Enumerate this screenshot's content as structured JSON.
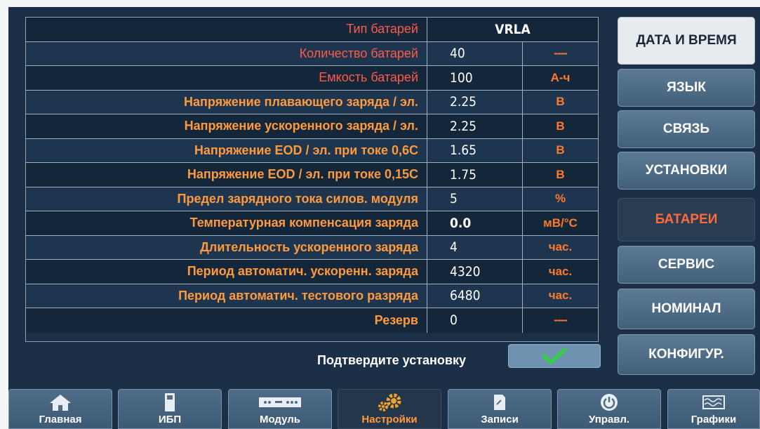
{
  "battery_table": {
    "rows": [
      {
        "label": "Тип батарей",
        "value": "VRLA",
        "unit": ""
      },
      {
        "label": "Количество батарей",
        "value": "40",
        "unit": "----"
      },
      {
        "label": "Емкость батарей",
        "value": "100",
        "unit": "А-ч"
      },
      {
        "label": "Напряжение плавающего заряда / эл.",
        "value": "2.25",
        "unit": "В"
      },
      {
        "label": "Напряжение ускоренного заряда / эл.",
        "value": "2.25",
        "unit": "В"
      },
      {
        "label": "Напряжение EOD / эл. при токе 0,6C",
        "value": "1.65",
        "unit": "В"
      },
      {
        "label": "Напряжение EOD / эл. при токе 0,15C",
        "value": "1.75",
        "unit": "В"
      },
      {
        "label": "Предел зарядного тока силов. модуля",
        "value": "5",
        "unit": "%"
      },
      {
        "label": "Температурная компенсация заряда",
        "value": "0.0",
        "unit": "мВ/°C"
      },
      {
        "label": "Длительность ускоренного заряда",
        "value": "4",
        "unit": "час."
      },
      {
        "label": "Период автоматич. ускоренн. заряда",
        "value": "4320",
        "unit": "час."
      },
      {
        "label": "Период автоматич. тестового разряда",
        "value": "6480",
        "unit": "час."
      },
      {
        "label": "Резерв",
        "value": "0",
        "unit": "----"
      }
    ]
  },
  "confirm": {
    "label": "Подтвердите установку"
  },
  "side_menu": {
    "items": [
      {
        "label": "ДАТА И ВРЕМЯ"
      },
      {
        "label": "ЯЗЫК"
      },
      {
        "label": "СВЯЗЬ"
      },
      {
        "label": "УСТАНОВКИ"
      },
      {
        "label": "БАТАРЕИ"
      },
      {
        "label": "СЕРВИС"
      },
      {
        "label": "НОМИНАЛ"
      },
      {
        "label": "КОНФИГУР."
      }
    ]
  },
  "bottom_nav": {
    "items": [
      {
        "label": "Главная",
        "icon": "home-icon"
      },
      {
        "label": "ИБП",
        "icon": "ups-icon"
      },
      {
        "label": "Модуль",
        "icon": "module-icon"
      },
      {
        "label": "Настройки",
        "icon": "settings-gears-icon"
      },
      {
        "label": "Записи",
        "icon": "records-icon"
      },
      {
        "label": "Управл.",
        "icon": "power-control-icon"
      },
      {
        "label": "Графики",
        "icon": "graphs-icon"
      }
    ]
  },
  "colors": {
    "background": "#1b3046",
    "label_orange": "#ff9a3c",
    "label_red": "#ff5a48",
    "active_tab": "#ff6a3c",
    "confirm_check": "#2fd33f"
  }
}
